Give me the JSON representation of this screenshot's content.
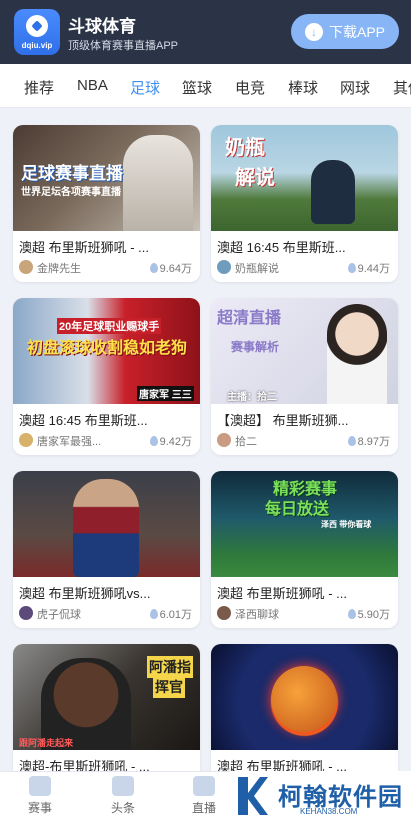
{
  "header": {
    "logo_domain": "dqiu.vip",
    "app_title": "斗球体育",
    "app_subtitle": "顶级体育赛事直播APP",
    "download_label": "下载APP"
  },
  "nav": {
    "items": [
      "推荐",
      "NBA",
      "足球",
      "篮球",
      "电竞",
      "棒球",
      "网球",
      "其他"
    ],
    "active": "足球"
  },
  "cards": [
    {
      "title": "澳超 布里斯班狮吼 - ...",
      "author": "金牌先生",
      "views": "9.64万",
      "overlay": [
        "足球赛事直播",
        "世界足坛各项赛事直播"
      ]
    },
    {
      "title": "澳超 16:45 布里斯班...",
      "author": "奶瓶解说",
      "views": "9.44万",
      "overlay": [
        "奶瓶",
        "解说"
      ]
    },
    {
      "title": "澳超 16:45 布里斯班...",
      "author": "唐家军最强...",
      "views": "9.42万",
      "overlay": [
        "20年足球职业赐球手",
        "初盘滚球收割稳如老狗",
        "唐家军 三三"
      ]
    },
    {
      "title": "【澳超】 布里斯班狮...",
      "author": "拾二",
      "views": "8.97万",
      "overlay": [
        "超清直播",
        "赛事解析",
        "主播：拾二"
      ]
    },
    {
      "title": "澳超 布里斯班狮吼vs...",
      "author": "虎子侃球",
      "views": "6.01万",
      "overlay": []
    },
    {
      "title": "澳超 布里斯班狮吼 - ...",
      "author": "泽西聊球",
      "views": "5.90万",
      "overlay": [
        "精彩赛事",
        "每日放送",
        "泽西  带你看球"
      ]
    },
    {
      "title": "澳超-布里斯班狮吼 - ...",
      "author": "",
      "views": "",
      "overlay": [
        "阿潘指",
        "挥官",
        "跟阿潘走起来"
      ]
    },
    {
      "title": "澳超 布里斯班狮吼 - ...",
      "author": "",
      "views": "",
      "overlay": []
    }
  ],
  "tabbar": {
    "items": [
      "赛事",
      "头条",
      "直播"
    ]
  },
  "watermark": {
    "name": "柯翰软件园",
    "site": "KEHAN38.COM"
  }
}
